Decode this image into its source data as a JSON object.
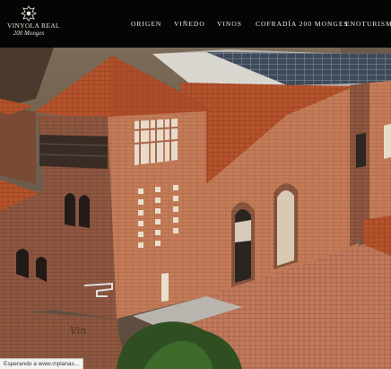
{
  "logo": {
    "name": "VINYOLA REAL",
    "subtitle": "200 Monges"
  },
  "nav": {
    "items": [
      {
        "label": "ORIGEN"
      },
      {
        "label": "VIÑEDO"
      },
      {
        "label": "VINOS"
      },
      {
        "label": "COFRADÍA 200 MONGES"
      },
      {
        "label": "ENOTURISMO"
      }
    ]
  },
  "status_bar": {
    "text": "Esperando a www.mplanas..."
  },
  "colors": {
    "navbar_bg": "#050505",
    "nav_text": "#f1ece3",
    "roof_tile": "#b5532c",
    "brick": "#c07a57"
  },
  "hero": {
    "image": "winery-building-photo"
  }
}
